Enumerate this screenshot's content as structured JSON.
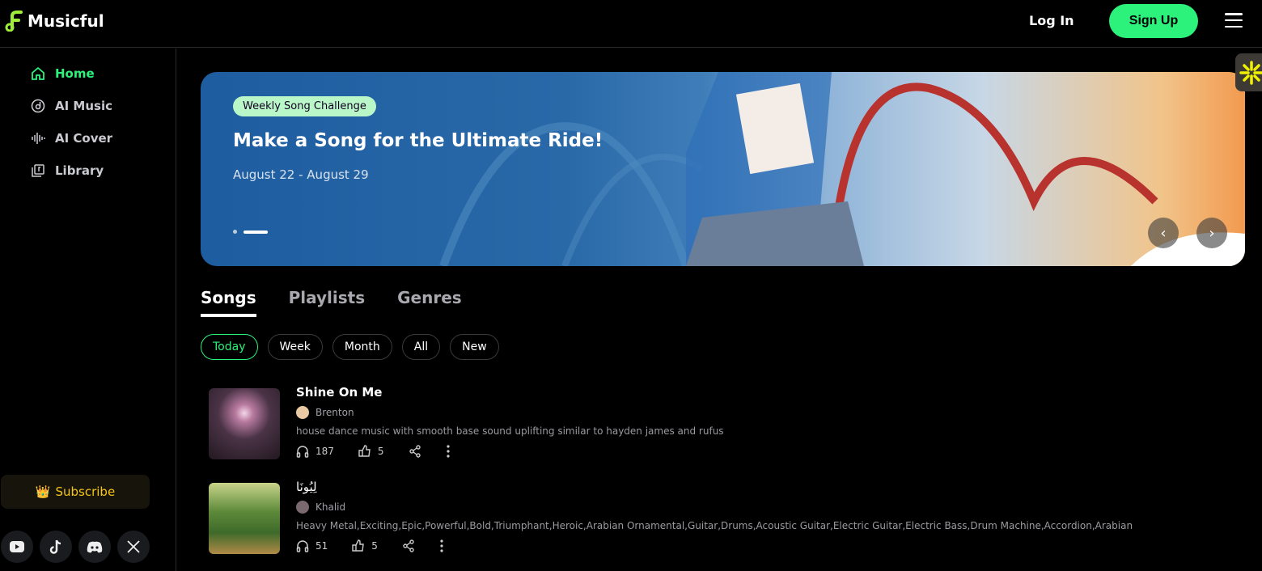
{
  "header": {
    "brand": "Musicful",
    "login": "Log In",
    "signup": "Sign Up"
  },
  "sidebar": {
    "items": [
      {
        "label": "Home",
        "icon": "home-icon",
        "active": true
      },
      {
        "label": "AI Music",
        "icon": "disc-icon"
      },
      {
        "label": "AI Cover",
        "icon": "waveform-icon"
      },
      {
        "label": "Library",
        "icon": "library-icon"
      }
    ],
    "subscribe": "Subscribe",
    "socials": [
      "youtube-icon",
      "tiktok-icon",
      "discord-icon",
      "x-icon"
    ]
  },
  "banner": {
    "badge": "Weekly Song Challenge",
    "title": "Make a Song for the Ultimate Ride!",
    "dates": "August 22 - August 29",
    "slides": 2,
    "active_slide": 2
  },
  "tabs": [
    {
      "label": "Songs",
      "active": true
    },
    {
      "label": "Playlists"
    },
    {
      "label": "Genres"
    }
  ],
  "filters": [
    {
      "label": "Today",
      "active": true
    },
    {
      "label": "Week"
    },
    {
      "label": "Month"
    },
    {
      "label": "All"
    },
    {
      "label": "New"
    }
  ],
  "songs": [
    {
      "title": "Shine On Me",
      "artist": "Brenton",
      "description": "house dance music with smooth base sound uplifting similar to hayden james and rufus",
      "plays": "187",
      "likes": "5"
    },
    {
      "title": "لِيُونَا",
      "artist": "Khalid",
      "description": "Heavy Metal,Exciting,Epic,Powerful,Bold,Triumphant,Heroic,Arabian Ornamental,Guitar,Drums,Acoustic Guitar,Electric Guitar,Electric Bass,Drum Machine,Accordion,Arabian",
      "plays": "51",
      "likes": "5"
    }
  ],
  "colors": {
    "accent": "#2cf27b",
    "subscribe": "#f5c518"
  }
}
